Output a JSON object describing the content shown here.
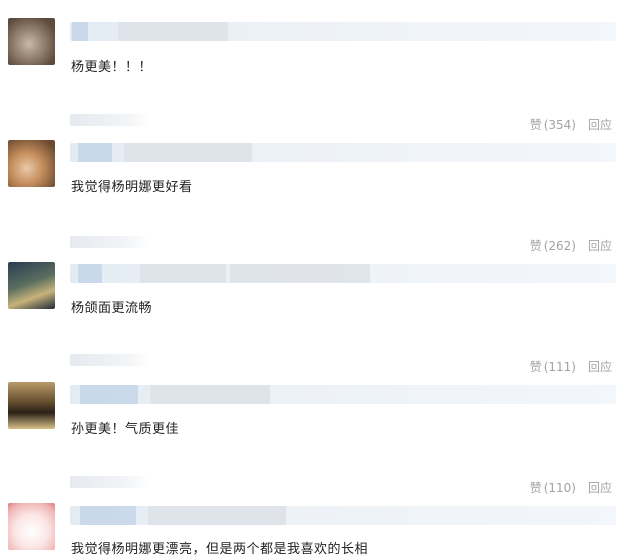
{
  "comments": [
    {
      "text": "杨更美！！！",
      "like_label": "赞",
      "like_count": "354",
      "reply_label": "回应"
    },
    {
      "text": "我觉得杨明娜更好看",
      "like_label": "赞",
      "like_count": "262",
      "reply_label": "回应"
    },
    {
      "text": "杨颌面更流畅",
      "like_label": "赞",
      "like_count": "111",
      "reply_label": "回应"
    },
    {
      "text": "孙更美！气质更佳",
      "like_label": "赞",
      "like_count": "110",
      "reply_label": "回应"
    },
    {
      "text": "我觉得杨明娜更漂亮，但是两个都是我喜欢的长相"
    }
  ],
  "colors": {
    "action_grey": "#a3a3a3",
    "blur_blue": "#d6e2ee",
    "text": "#222222"
  },
  "icons": {
    "like": "like-icon"
  }
}
